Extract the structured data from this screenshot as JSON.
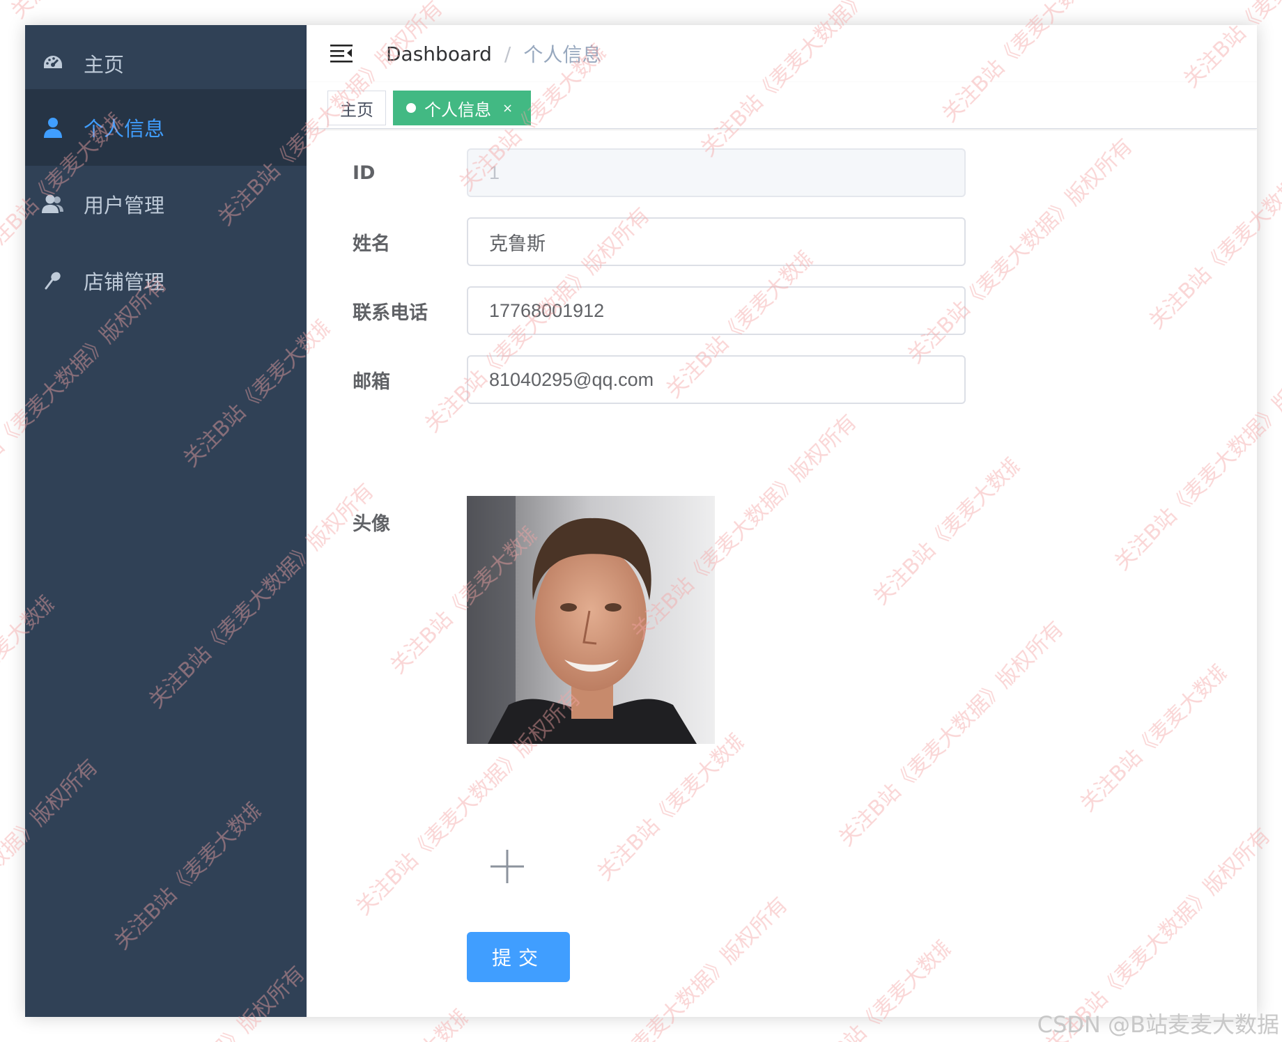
{
  "sidebar": {
    "items": [
      {
        "label": "主页",
        "icon": "dashboard-icon",
        "active": false
      },
      {
        "label": "个人信息",
        "icon": "user-icon",
        "active": true
      },
      {
        "label": "用户管理",
        "icon": "users-icon",
        "active": false
      },
      {
        "label": "店铺管理",
        "icon": "brush-icon",
        "active": false
      }
    ]
  },
  "navbar": {
    "breadcrumb": [
      "Dashboard",
      "个人信息"
    ],
    "separator": "/"
  },
  "tags": [
    {
      "label": "主页",
      "active": false
    },
    {
      "label": "个人信息",
      "active": true,
      "close": "×"
    }
  ],
  "form": {
    "fields": [
      {
        "label": "ID",
        "value": "1",
        "disabled": true
      },
      {
        "label": "姓名",
        "value": "克鲁斯",
        "disabled": false
      },
      {
        "label": "联系电话",
        "value": "17768001912",
        "disabled": false
      },
      {
        "label": "邮箱",
        "value": "81040295@qq.com",
        "disabled": false
      }
    ],
    "avatar_label": "头像",
    "upload_icon": "plus-icon",
    "submit_label": "提交"
  },
  "watermark": {
    "text": "关注B站《麦麦大数据》版权所有"
  },
  "footer": {
    "credit": "CSDN @B站麦麦大数据"
  },
  "colors": {
    "sidebar_bg": "#304156",
    "sidebar_active_bg": "#263445",
    "sidebar_text": "#bfcbd9",
    "accent": "#409eff",
    "tag_active": "#42b983",
    "watermark": "#f5a5a5"
  }
}
